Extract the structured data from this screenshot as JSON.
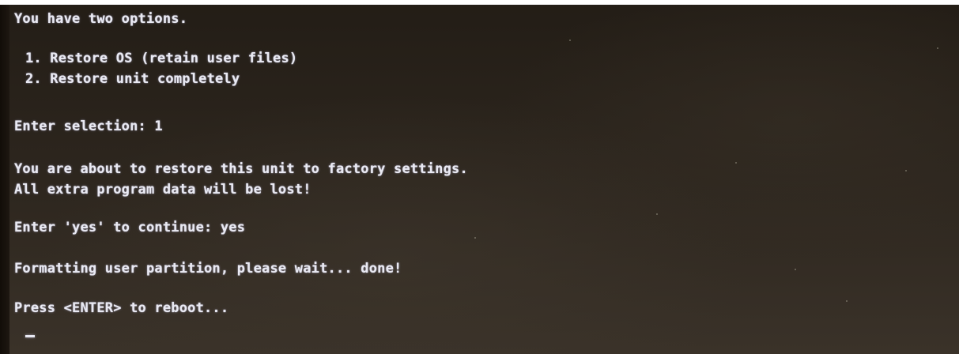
{
  "terminal": {
    "line_options_intro": "You have two options.",
    "option_1": "1. Restore OS (retain user files)",
    "option_2": "2. Restore unit completely",
    "selection_prompt": "Enter selection: 1",
    "warning_line_1": "You are about to restore this unit to factory settings.",
    "warning_line_2": "All extra program data will be lost!",
    "confirm_prompt": "Enter 'yes' to continue: yes",
    "formatting_status": "Formatting user partition, please wait... done!",
    "reboot_prompt": "Press <ENTER> to reboot..."
  },
  "colors": {
    "text": "#e9e9f2",
    "background": "#2e271f"
  }
}
